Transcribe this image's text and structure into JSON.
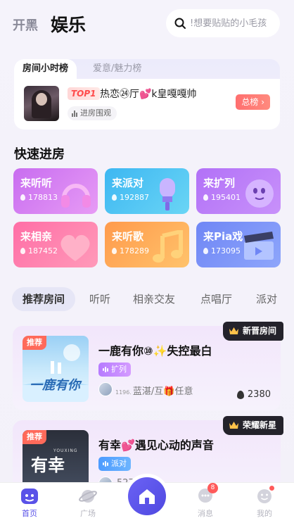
{
  "header": {
    "tab_inactive": "开黑",
    "tab_active": "娱乐",
    "search_placeholder": "!想要贴贴的小毛孩"
  },
  "ranking": {
    "tab_active": "房间小时榜",
    "tab_inactive": "爱意/魅力榜",
    "top_badge": "TOP1",
    "room_name": "热恋㉔厅💕k皇嘎嘎帅",
    "enter_label": "进房围观",
    "total_label": "总榜 ›"
  },
  "quick_entry": {
    "title": "快速进房",
    "items": [
      {
        "label": "来听听",
        "count": "178813",
        "icon": "headphones-icon",
        "color": "#c86df0"
      },
      {
        "label": "来派对",
        "count": "192887",
        "icon": "microphone-icon",
        "color": "#3db7f2"
      },
      {
        "label": "来扩列",
        "count": "195401",
        "icon": "bubble-face-icon",
        "color": "#b271f7"
      },
      {
        "label": "来相亲",
        "count": "187452",
        "icon": "heart-icon",
        "color": "#ff6ea6"
      },
      {
        "label": "来听歌",
        "count": "178289",
        "icon": "music-note-icon",
        "color": "#ff9a4c"
      },
      {
        "label": "来Pia戏",
        "count": "173095",
        "icon": "clapperboard-icon",
        "color": "#6f86f5"
      }
    ]
  },
  "categories": [
    "推荐房间",
    "听听",
    "相亲交友",
    "点唱厅",
    "派对"
  ],
  "rooms": [
    {
      "badge": "新晋房间",
      "tag": "推荐",
      "cover_text": "一鹿有你",
      "title": "一鹿有你⑩✨失控最白",
      "type": "扩列",
      "host_prefix": "1196.",
      "host": "蓝湛/互🎁任意",
      "heat": "2380"
    },
    {
      "badge": "荣耀新星",
      "tag": "推荐",
      "cover_text": "有幸",
      "cover_sub": "YOUXING",
      "title": "有幸💕遇见心动的声音",
      "type": "派对",
      "host_prefix": "",
      "host": "527",
      "heat": ""
    }
  ],
  "bottom_nav": {
    "home": "首页",
    "square": "广场",
    "messages": "消息",
    "message_count": "8",
    "mine": "我的"
  },
  "colors": {
    "accent": "#5a52e8",
    "hot": "#ff5a5a"
  }
}
